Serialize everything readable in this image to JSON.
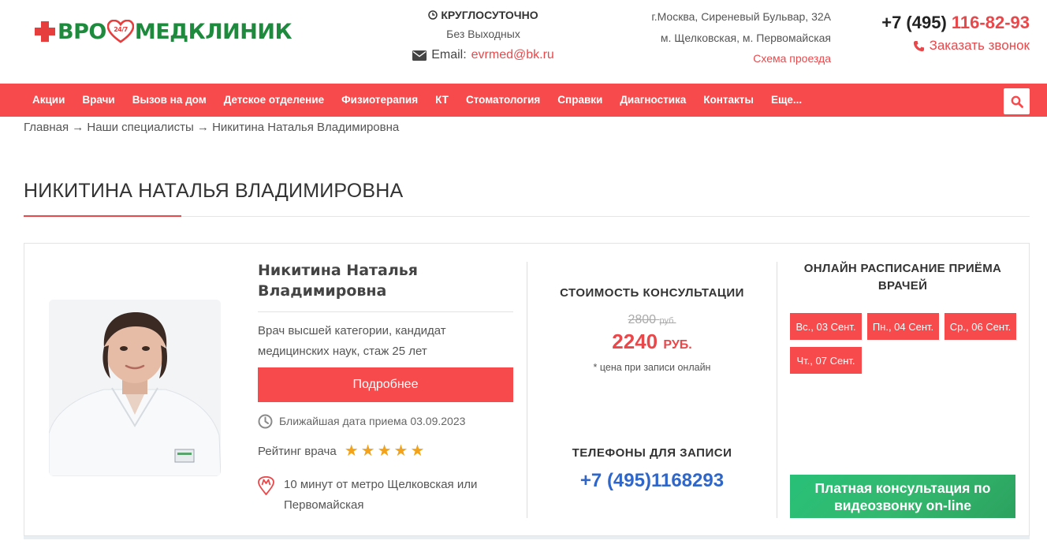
{
  "header": {
    "logo_prefix": "ВРО",
    "logo_badge": "24/7",
    "logo_suffix": "МЕДКЛИНИК",
    "hours_title": "КРУГЛОСУТОЧНО",
    "hours_sub": "Без Выходных",
    "email_label": "Email:",
    "email": "evrmed@bk.ru",
    "address_line1": "г.Москва, Сиреневый Бульвар, 32А",
    "address_line2": "м. Щелковская, м. Первомайская",
    "route_link": "Схема проезда",
    "phone_prefix": "+7 (495)",
    "phone_accent": "116-82-93",
    "callback_label": "Заказать звонок"
  },
  "nav": {
    "items": [
      "Акции",
      "Врачи",
      "Вызов на дом",
      "Детское отделение",
      "Физиотерапия",
      "КТ",
      "Стоматология",
      "Справки",
      "Диагностика",
      "Контакты",
      "Еще..."
    ]
  },
  "breadcrumb": {
    "text": "Главная → Наши специалисты → Никитина Наталья Владимировна"
  },
  "page": {
    "title": "НИКИТИНА НАТАЛЬЯ ВЛАДИМИРОВНА"
  },
  "doctor": {
    "name_line1": "Никитина Наталья",
    "name_line2": "Владимировна",
    "description": "Врач высшей категории, кандидат медицинских наук, стаж 25 лет",
    "more_button": "Подробнее",
    "nearest_date": "Ближайшая дата приема 03.09.2023",
    "rating_label": "Рейтинг врача",
    "rating_stars": 5,
    "metro_text": "10 минут от метро Щелковская или Первомайская"
  },
  "price": {
    "heading": "СТОИМОСТЬ КОНСУЛЬТАЦИИ",
    "old_value": "2800",
    "old_currency": "руб.",
    "new_value": "2240",
    "new_currency": "РУБ.",
    "note": "* цена при записи онлайн"
  },
  "phones": {
    "heading": "ТЕЛЕФОНЫ ДЛЯ ЗАПИСИ",
    "number": "+7 (495)1168293"
  },
  "schedule": {
    "heading": "ОНЛАЙН РАСПИСАНИЕ ПРИЁМА ВРАЧЕЙ",
    "slots": [
      "Вс., 03 Сент.",
      "Пн., 04 Сент.",
      "Ср., 06 Сент.",
      "Чт., 07 Сент."
    ],
    "video_button": "Платная консультация по видеозвонку on-line"
  },
  "colors": {
    "accent": "#f74a4d",
    "brand_green": "#1e8a3e",
    "phone_blue": "#2f66c9"
  }
}
